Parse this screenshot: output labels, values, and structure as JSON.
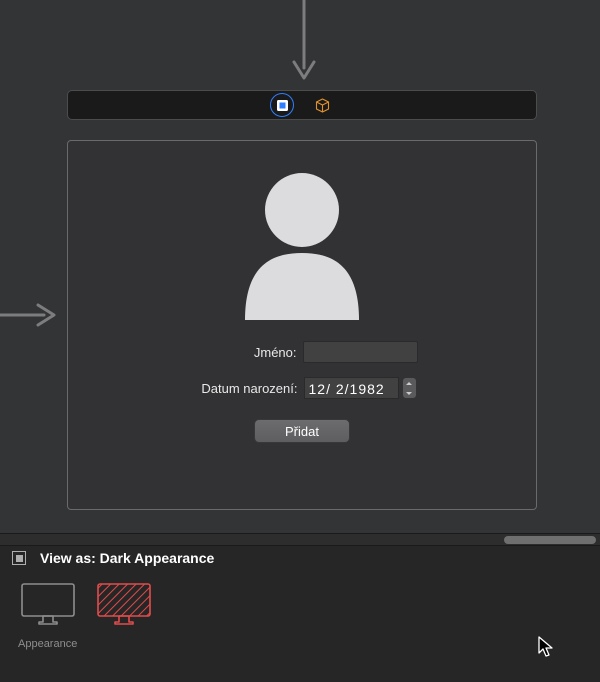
{
  "form": {
    "name_label": "Jméno:",
    "dob_label": "Datum narození:",
    "dob_value": "12/  2/1982",
    "add_button": "Přidat"
  },
  "inspector": {
    "disclosure_title": "View as: Dark Appearance",
    "caption_appearance": "Appearance"
  }
}
